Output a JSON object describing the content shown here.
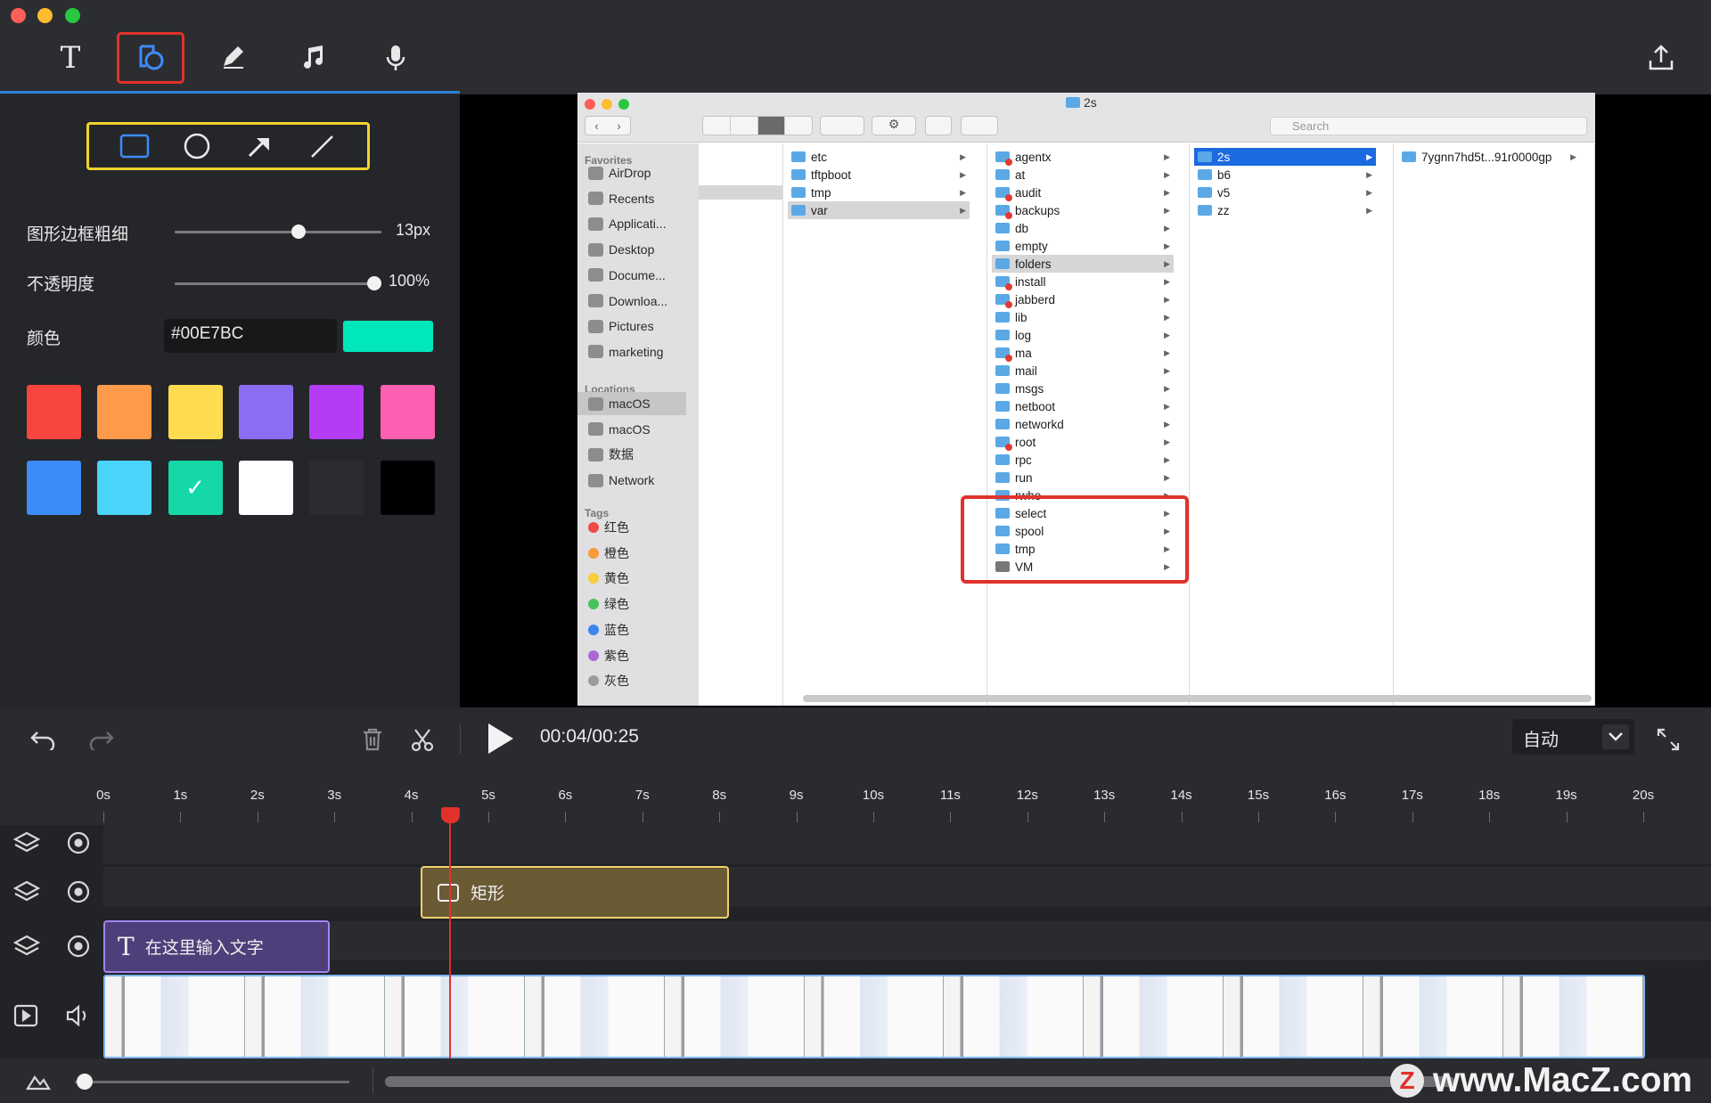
{
  "toolbar": {
    "tools": [
      {
        "name": "text-tool",
        "icon": "text-icon"
      },
      {
        "name": "shape-tool",
        "icon": "shape-icon",
        "active": true
      },
      {
        "name": "pen-tool",
        "icon": "pen-icon"
      },
      {
        "name": "music-tool",
        "icon": "music-icon"
      },
      {
        "name": "mic-tool",
        "icon": "mic-icon"
      }
    ],
    "export_icon": "export-icon",
    "active_color": "#e0322b"
  },
  "shape_panel": {
    "shapes": [
      "rectangle",
      "circle",
      "arrow",
      "line"
    ],
    "border_width_label": "图形边框粗细",
    "border_width_value": "13px",
    "border_width_fraction": 0.6,
    "opacity_label": "不透明度",
    "opacity_value": "100%",
    "opacity_fraction": 1.0,
    "color_label": "颜色",
    "color_hex": "#00E7BC",
    "swatches": [
      "#f8453f",
      "#ff9a4a",
      "#ffdc4f",
      "#8c6cf2",
      "#b43cf5",
      "#ff5fb0",
      "#3c8cf7",
      "#4ad4f9",
      "#14d8a8",
      "#ffffff",
      "#2b2c2f",
      "#000000"
    ],
    "selected_swatch": 8
  },
  "finder": {
    "title": "2s",
    "search_placeholder": "Search",
    "sidebar": {
      "favorites_header": "Favorites",
      "favorites": [
        "AirDrop",
        "Recents",
        "Applicati...",
        "Desktop",
        "Docume...",
        "Downloa...",
        "Pictures",
        "marketing"
      ],
      "locations_header": "Locations",
      "locations": [
        "macOS",
        "macOS",
        "数据",
        "Network"
      ],
      "tags_header": "Tags",
      "tags": [
        {
          "name": "红色",
          "color": "#f04a45"
        },
        {
          "name": "橙色",
          "color": "#f69a3b"
        },
        {
          "name": "黄色",
          "color": "#f6cd3a"
        },
        {
          "name": "绿色",
          "color": "#47c35a"
        },
        {
          "name": "蓝色",
          "color": "#3a86f0"
        },
        {
          "name": "紫色",
          "color": "#a869d4"
        },
        {
          "name": "灰色",
          "color": "#9b9b9b"
        }
      ]
    },
    "col2": [
      "etc",
      "tftpboot",
      "tmp",
      "var"
    ],
    "col3": [
      "agentx",
      "at",
      "audit",
      "backups",
      "db",
      "empty",
      "folders",
      "install",
      "jabberd",
      "lib",
      "log",
      "ma",
      "mail",
      "msgs",
      "netboot",
      "networkd",
      "root",
      "rpc",
      "run",
      "rwho",
      "select",
      "spool",
      "tmp",
      "VM"
    ],
    "col4": [
      "2s",
      "b6",
      "v5",
      "zz"
    ],
    "col5": [
      "7ygnn7hd5t...91r0000gp"
    ]
  },
  "controls": {
    "timecode": "00:04/00:25",
    "zoom_mode": "自动"
  },
  "timeline": {
    "ticks": [
      "0s",
      "1s",
      "2s",
      "3s",
      "4s",
      "5s",
      "6s",
      "7s",
      "8s",
      "9s",
      "10s",
      "11s",
      "12s",
      "13s",
      "14s",
      "15s",
      "16s",
      "17s",
      "18s",
      "19s",
      "20s"
    ],
    "playhead_seconds": 4.5,
    "rect_clip_label": "矩形",
    "text_clip_label": "在这里输入文字"
  },
  "watermark": {
    "logo": "Z",
    "text": "www.MacZ.com"
  }
}
